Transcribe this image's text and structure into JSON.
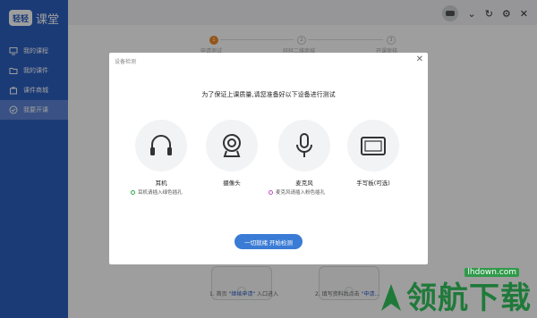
{
  "app": {
    "logo_badge": "轻轻",
    "logo_text": "课堂"
  },
  "sidebar": {
    "items": [
      {
        "label": "我的课程",
        "icon": "monitor-icon"
      },
      {
        "label": "我的课件",
        "icon": "folder-icon"
      },
      {
        "label": "课件商城",
        "icon": "store-icon"
      },
      {
        "label": "我要开课",
        "icon": "check-circle-icon"
      }
    ]
  },
  "topbar": {
    "chevron": "⌄",
    "refresh": "↻",
    "settings": "⚙",
    "close": "✕"
  },
  "steps": {
    "items": [
      {
        "num": "1",
        "label": "申请测试"
      },
      {
        "num": "2",
        "label": "轻轻二维商城"
      },
      {
        "num": "3",
        "label": "开课审核"
      }
    ]
  },
  "background": {
    "note1_prefix": "1. 首页",
    "note1_link": "\"继续申请\"",
    "note1_suffix": "入口进入",
    "note2_prefix": "2. 填写资料后点击",
    "note2_link": "\"申请..."
  },
  "dialog": {
    "title": "设备检测",
    "close": "✕",
    "instruction": "为了保证上课质量,请您准备好以下设备进行测试",
    "devices": [
      {
        "name": "耳机",
        "icon": "headphones-icon"
      },
      {
        "name": "摄像头",
        "icon": "webcam-icon"
      },
      {
        "name": "麦克风",
        "icon": "microphone-icon"
      },
      {
        "name": "手写板(可选)",
        "icon": "tablet-icon"
      }
    ],
    "status": [
      {
        "text": "耳机请插入绿色插孔",
        "color": "#2eaa4b"
      },
      {
        "text": "麦克风请插入粉色插孔",
        "color": "#c24fc4"
      }
    ],
    "start_button": "一切就绪 开始检测"
  },
  "watermark": {
    "text": "领航下载",
    "site": "lhdown.com"
  },
  "colors": {
    "brand": "#2d5fc1",
    "accent": "#f08a2a",
    "button": "#3a7bd5"
  }
}
